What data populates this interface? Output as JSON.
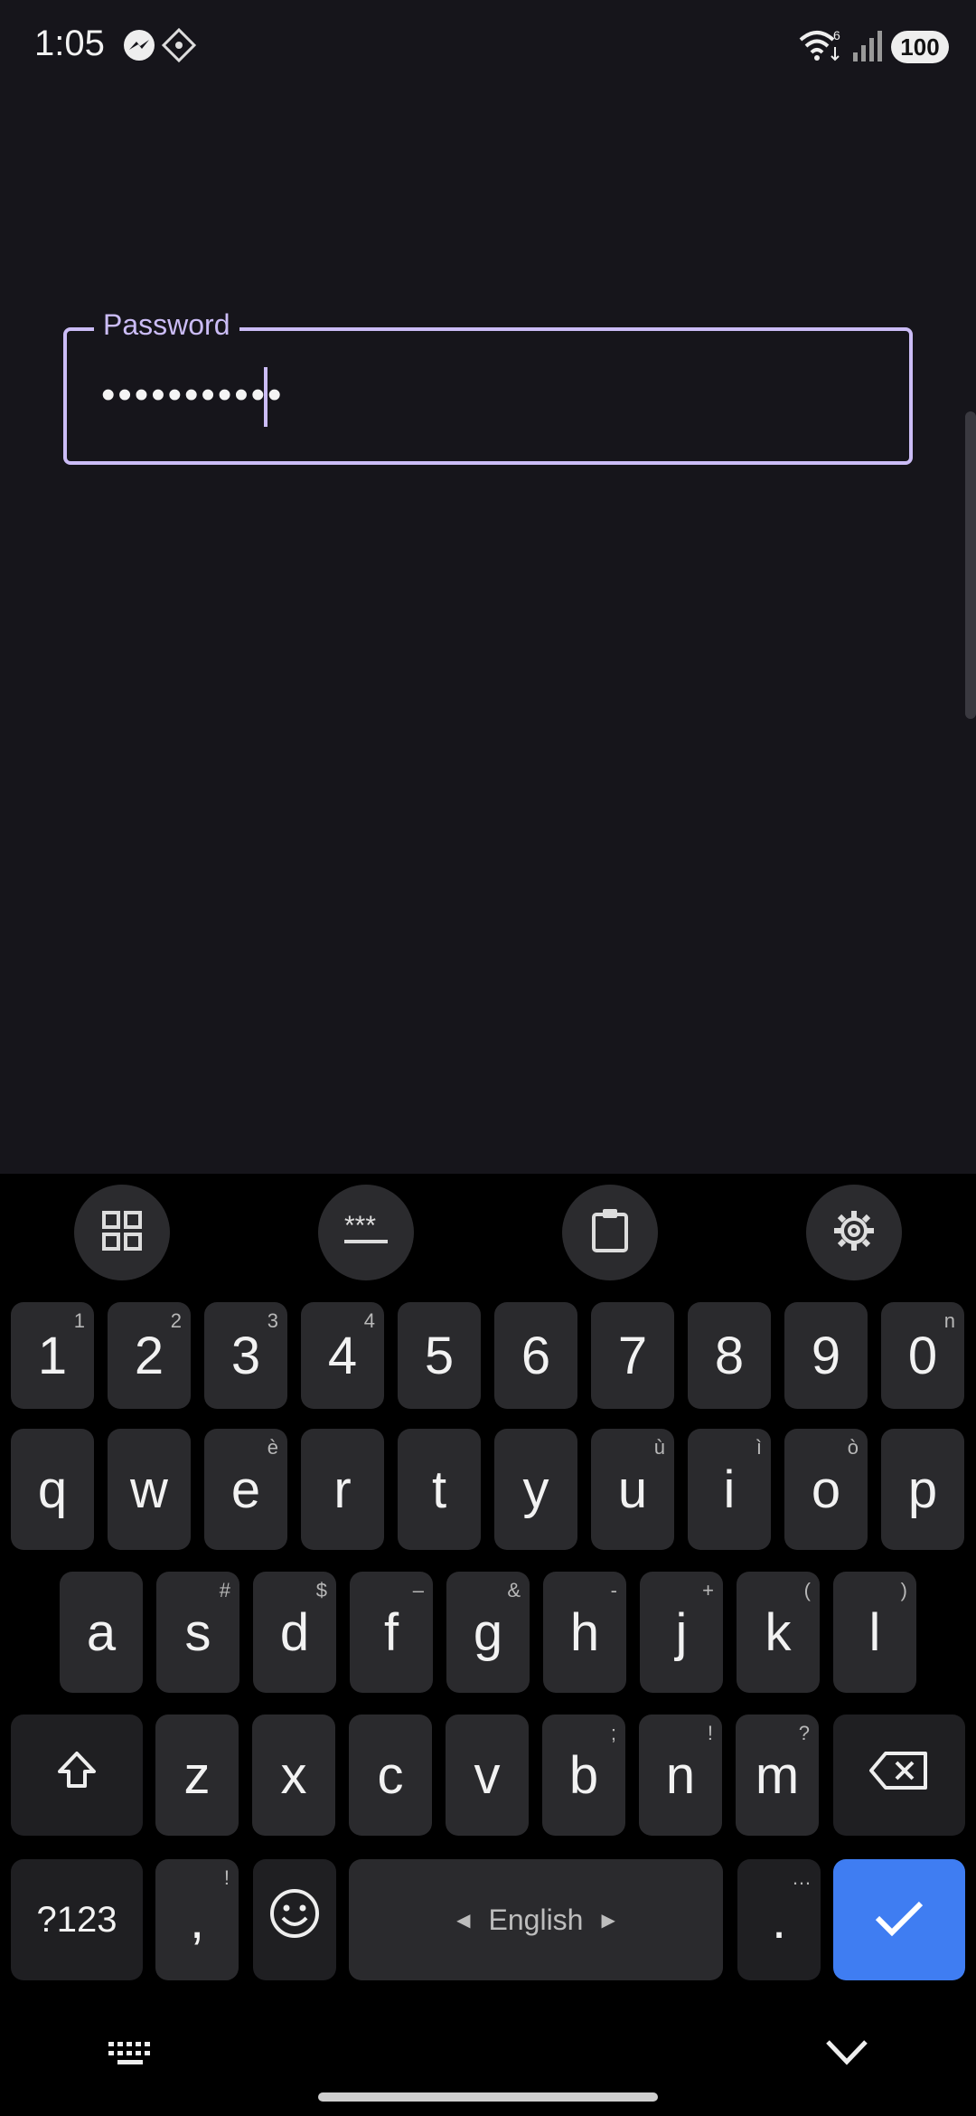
{
  "status_bar": {
    "time": "1:05",
    "battery": "100",
    "icons": [
      "messenger-icon",
      "app-diamond-icon",
      "wifi-icon",
      "signal-icon",
      "battery-icon"
    ]
  },
  "form": {
    "password_label": "Password",
    "password_value": "•••••••••••"
  },
  "keyboard": {
    "toolbar": [
      "apps-grid-icon",
      "password-mask-icon",
      "clipboard-icon",
      "settings-gear-icon"
    ],
    "row_numbers": [
      {
        "k": "1",
        "h": "1"
      },
      {
        "k": "2",
        "h": "2"
      },
      {
        "k": "3",
        "h": "3"
      },
      {
        "k": "4",
        "h": "4"
      },
      {
        "k": "5",
        "h": ""
      },
      {
        "k": "6",
        "h": ""
      },
      {
        "k": "7",
        "h": ""
      },
      {
        "k": "8",
        "h": ""
      },
      {
        "k": "9",
        "h": ""
      },
      {
        "k": "0",
        "h": "n"
      }
    ],
    "row_top": [
      {
        "k": "q",
        "h": ""
      },
      {
        "k": "w",
        "h": ""
      },
      {
        "k": "e",
        "h": "è"
      },
      {
        "k": "r",
        "h": ""
      },
      {
        "k": "t",
        "h": ""
      },
      {
        "k": "y",
        "h": ""
      },
      {
        "k": "u",
        "h": "ù"
      },
      {
        "k": "i",
        "h": "ì"
      },
      {
        "k": "o",
        "h": "ò"
      },
      {
        "k": "p",
        "h": ""
      }
    ],
    "row_mid": [
      {
        "k": "a",
        "h": ""
      },
      {
        "k": "s",
        "h": "#"
      },
      {
        "k": "d",
        "h": "$"
      },
      {
        "k": "f",
        "h": "–"
      },
      {
        "k": "g",
        "h": "&"
      },
      {
        "k": "h",
        "h": "-"
      },
      {
        "k": "j",
        "h": "+"
      },
      {
        "k": "k",
        "h": "("
      },
      {
        "k": "l",
        "h": ")"
      }
    ],
    "row_bottom": [
      {
        "k": "z",
        "h": ""
      },
      {
        "k": "x",
        "h": ""
      },
      {
        "k": "c",
        "h": ""
      },
      {
        "k": "v",
        "h": ""
      },
      {
        "k": "b",
        "h": ";"
      },
      {
        "k": "n",
        "h": "!"
      },
      {
        "k": "m",
        "h": "?"
      }
    ],
    "symbols_label": "?123",
    "comma_label": ",",
    "comma_hint": "!",
    "space_label": "English",
    "period_label": ".",
    "period_hint": "…",
    "accent_color": "#3f7df2"
  }
}
